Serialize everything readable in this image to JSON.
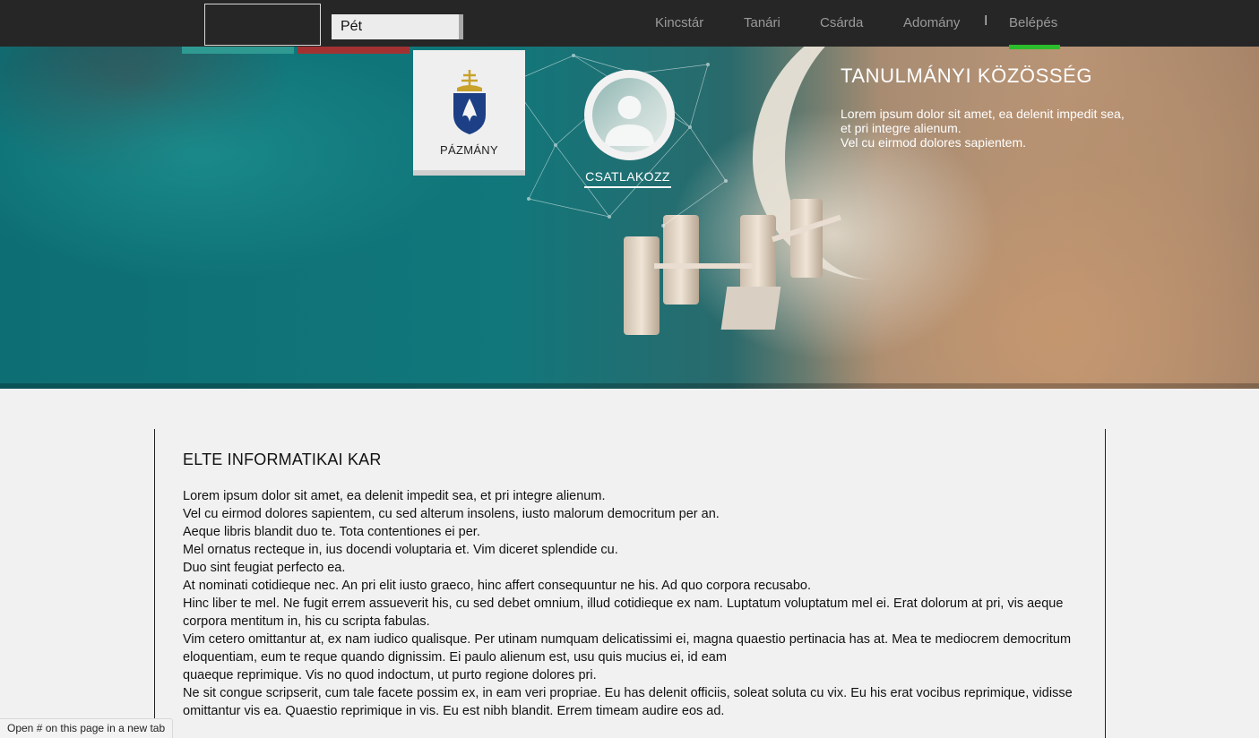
{
  "search": {
    "value": "Pét"
  },
  "nav": {
    "items": [
      {
        "label": "Kincstár"
      },
      {
        "label": "Tanári"
      },
      {
        "label": "Csárda"
      },
      {
        "label": "Adomány"
      }
    ],
    "separator": "I",
    "login_label": "Belépés"
  },
  "colors": {
    "topbar": "#262626",
    "active_nav": "#2bbd2b",
    "strip_teal": "#2f9a92",
    "strip_red": "#a23232"
  },
  "hero": {
    "partner_name": "PÁZMÁNY",
    "join_label": "CSATLAKOZZ",
    "title": "TANULMÁNYI KÖZÖSSÉG",
    "text_lines": [
      "Lorem ipsum dolor sit amet, ea delenit impedit sea,",
      "et pri integre alienum.",
      "Vel cu eirmod dolores sapientem."
    ]
  },
  "main": {
    "title": "ELTE INFORMATIKAI KAR",
    "lines": [
      "Lorem ipsum dolor sit amet, ea delenit impedit sea, et pri integre alienum.",
      "Vel cu eirmod dolores sapientem, cu sed alterum insolens, iusto malorum democritum per an.",
      "Aeque libris blandit duo te. Tota contentiones ei per.",
      "Mel ornatus recteque in, ius docendi voluptaria et. Vim diceret splendide cu.",
      "Duo sint feugiat perfecto ea.",
      "At nominati cotidieque nec. An pri elit iusto graeco, hinc affert consequuntur ne his. Ad quo corpora recusabo.",
      "Hinc liber te mel. Ne fugit errem assueverit his, cu sed debet omnium, illud cotidieque ex nam. Luptatum voluptatum mel ei. Erat dolorum at pri, vis aeque corpora mentitum in, his cu scripta fabulas.",
      "Vim cetero omittantur at, ex nam iudico qualisque. Per utinam numquam delicatissimi ei, magna quaestio pertinacia has at. Mea te mediocrem democritum eloquentiam, eum te reque quando dignissim. Ei paulo alienum est, usu quis mucius ei, id eam",
      "quaeque reprimique. Vis no quod indoctum, ut purto regione dolores pri.",
      "Ne sit congue scripserit, cum tale facete possim ex, in eam veri propriae. Eu has delenit officiis, soleat soluta cu vix. Eu his erat vocibus reprimique, vidisse omittantur vis ea. Quaestio reprimique in vis. Eu est nibh blandit. Errem timeam audire eos ad."
    ]
  },
  "status_bar": {
    "text": "Open # on this page in a new tab"
  }
}
